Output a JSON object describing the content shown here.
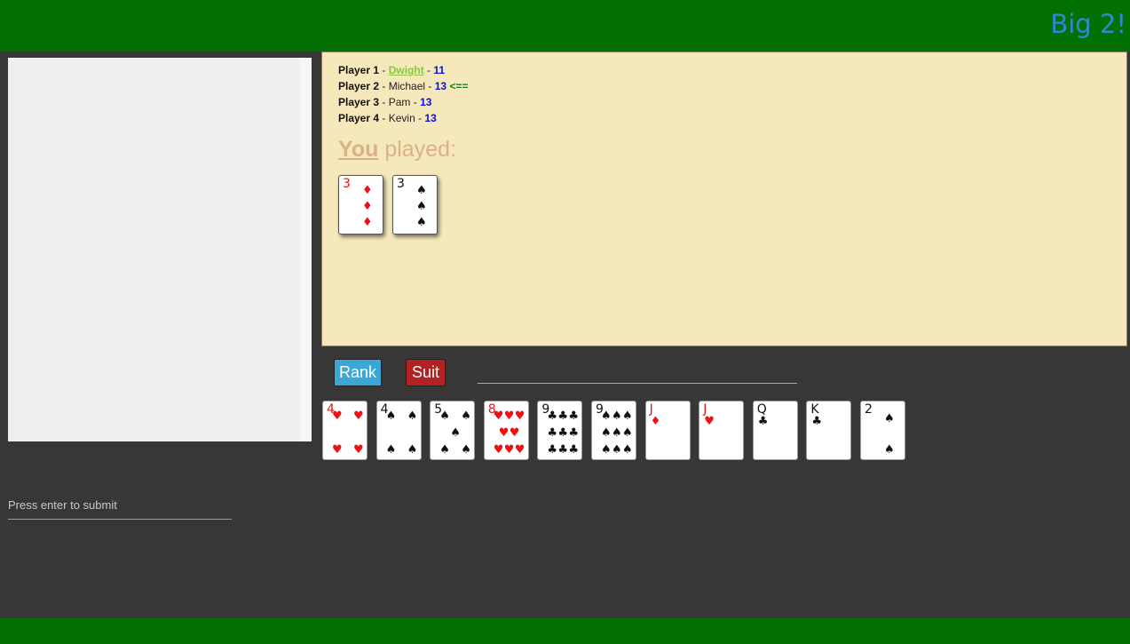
{
  "header": {
    "title": "Big 2!"
  },
  "players": [
    {
      "label": "Player 1",
      "name": "Dwight",
      "count": "11",
      "active": true,
      "turn": ""
    },
    {
      "label": "Player 2",
      "name": "Michael",
      "count": "13",
      "active": false,
      "turn": "<=="
    },
    {
      "label": "Player 3",
      "name": "Pam",
      "count": "13",
      "active": false,
      "turn": ""
    },
    {
      "label": "Player 4",
      "name": "Kevin",
      "count": "13",
      "active": false,
      "turn": ""
    }
  ],
  "played": {
    "who": "You",
    "text": "played:",
    "cards": [
      {
        "rank": "3",
        "suit": "♦",
        "color": "red"
      },
      {
        "rank": "3",
        "suit": "♠",
        "color": "black"
      }
    ]
  },
  "controls": {
    "rank_label": "Rank",
    "suit_label": "Suit",
    "play_input_value": ""
  },
  "hand": [
    {
      "rank": "4",
      "suit": "♥",
      "color": "red"
    },
    {
      "rank": "4",
      "suit": "♠",
      "color": "black"
    },
    {
      "rank": "5",
      "suit": "♠",
      "color": "black"
    },
    {
      "rank": "8",
      "suit": "♥",
      "color": "red"
    },
    {
      "rank": "9",
      "suit": "♣",
      "color": "black"
    },
    {
      "rank": "9",
      "suit": "♠",
      "color": "black"
    },
    {
      "rank": "J",
      "suit": "♦",
      "color": "red"
    },
    {
      "rank": "J",
      "suit": "♥",
      "color": "red"
    },
    {
      "rank": "Q",
      "suit": "♣",
      "color": "black"
    },
    {
      "rank": "K",
      "suit": "♣",
      "color": "black"
    },
    {
      "rank": "2",
      "suit": "♠",
      "color": "black"
    }
  ],
  "chat": {
    "placeholder": "Press enter to submit",
    "value": ""
  },
  "colors": {
    "header_green": "#027002",
    "table_felt": "#f5e9bb",
    "rank_button": "#3aa7d6",
    "suit_button": "#b22222",
    "red_suit": "#ee1111"
  }
}
